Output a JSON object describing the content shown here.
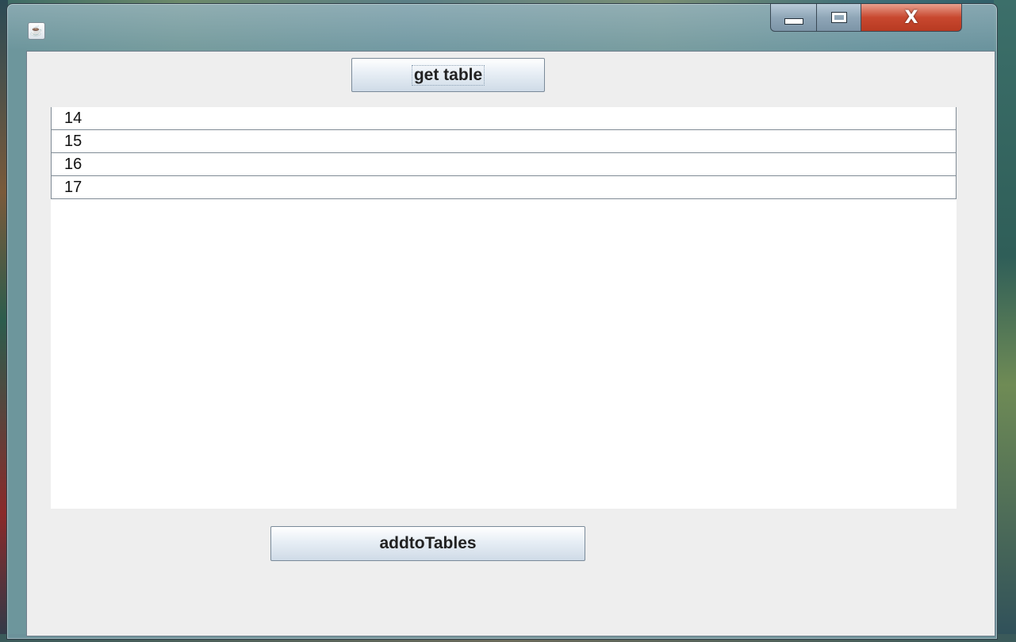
{
  "window": {
    "app_icon": "java-icon",
    "controls": {
      "minimize": "minimize-icon",
      "maximize": "maximize-icon",
      "close": "close-icon",
      "close_glyph": "X"
    }
  },
  "buttons": {
    "get_table": "get table",
    "add_to_tables": "addtoTables"
  },
  "table": {
    "rows": [
      "14",
      "15",
      "16",
      "17"
    ]
  },
  "colors": {
    "panel_background": "#eeeeee",
    "close_button": "#c8482f"
  }
}
